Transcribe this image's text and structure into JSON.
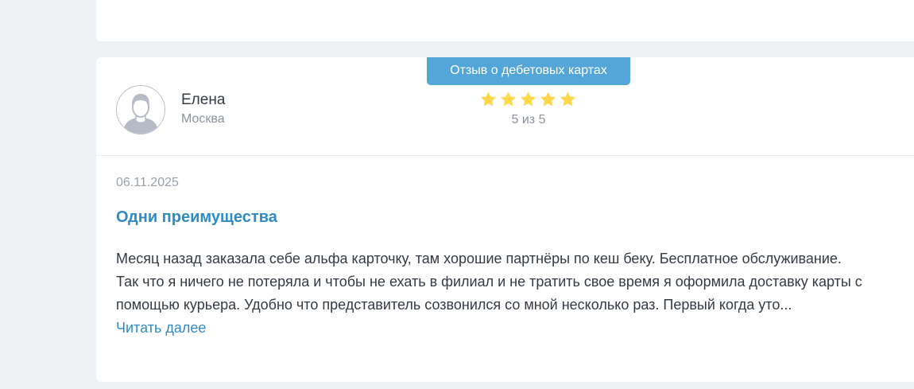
{
  "review": {
    "category_badge": "Отзыв о дебетовых картах",
    "author": {
      "name": "Елена",
      "city": "Москва",
      "avatar_icon": "user-avatar-icon"
    },
    "rating": {
      "value": 5,
      "max": 5,
      "label": "5 из 5",
      "star_color": "#ffd74b",
      "star_icon": "star-icon"
    },
    "date": "06.11.2025",
    "title": "Одни преимущества",
    "text_lines": [
      "Месяц назад заказала себе альфа карточку, там хорошие партнёры по кеш беку. Бесплатное обслуживание.",
      "Так что я ничего не потеряла и чтобы не ехать в филиал и не тратить свое время я оформила доставку карты с",
      "помощью курьера. Удобно что представитель созвонился со мной несколько раз. Первый когда уто..."
    ],
    "read_more": "Читать далее"
  },
  "colors": {
    "page_background": "#eef1f4",
    "card_background": "#ffffff",
    "badge_background": "#55a6d8",
    "link": "#2f8bc6",
    "text": "#333a44",
    "muted": "#8c939d"
  }
}
